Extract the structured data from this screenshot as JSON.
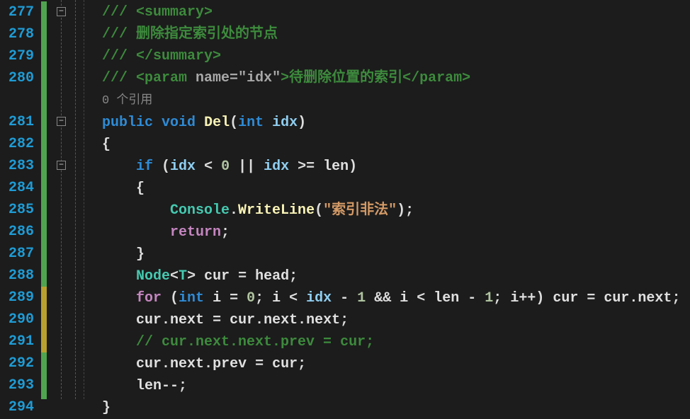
{
  "lines": {
    "n277": "277",
    "n278": "278",
    "n279": "279",
    "n280": "280",
    "n281": "281",
    "n282": "282",
    "n283": "283",
    "n284": "284",
    "n285": "285",
    "n286": "286",
    "n287": "287",
    "n288": "288",
    "n289": "289",
    "n290": "290",
    "n291": "291",
    "n292": "292",
    "n293": "293",
    "n294": "294"
  },
  "code": {
    "slash277": "/// ",
    "sum_open": "<summary>",
    "slash278": "/// ",
    "sum_text": "删除指定索引处的节点",
    "slash279": "/// ",
    "sum_close": "</summary>",
    "slash280": "/// ",
    "param_open": "<param ",
    "param_name_attr": "name",
    "param_eq": "=",
    "param_val": "\"idx\"",
    "param_close_gt": ">",
    "param_desc": "待删除位置的索引",
    "param_close": "</param>",
    "ref_text": "0 个引用",
    "public": "public",
    "void": "void",
    "del": "Del",
    "lparen": "(",
    "int": "int",
    "idx": "idx",
    "rparen": ")",
    "lbrace": "{",
    "if": "if",
    "cond_open": " (",
    "idx2": "idx",
    "lt": " < ",
    "zero": "0",
    "or": " || ",
    "idx3": "idx",
    "gte": " >= ",
    "len": "len",
    "cond_close": ")",
    "lbrace2": "{",
    "console": "Console",
    "dot1": ".",
    "writeline": "WriteLine",
    "wl_open": "(",
    "wl_str": "\"索引非法\"",
    "wl_close": ")",
    "semi1": ";",
    "return": "return",
    "semi2": ";",
    "rbrace2": "}",
    "node": "Node",
    "lt_gen": "<",
    "t": "T",
    "gt_gen": ">",
    "cur": " cur ",
    "eq1": "= ",
    "head": "head",
    "semi3": ";",
    "for": "for",
    "for_open": " (",
    "int2": "int",
    "i": " i ",
    "eq2": "= ",
    "zero2": "0",
    "sc1": "; ",
    "i2": "i",
    "lt2": " < ",
    "idx4": "idx",
    "minus1": " - ",
    "one1": "1",
    "and": " && ",
    "i3": "i",
    "lt3": " < ",
    "len2": "len",
    "minus2": " - ",
    "one2": "1",
    "sc2": "; ",
    "i4": "i",
    "inc": "++",
    "for_close": ") ",
    "cur2": "cur",
    "eq3": " = ",
    "cur3": "cur",
    "dot2": ".",
    "next1": "next",
    "semi4": ";",
    "cur4": "cur",
    "dot3": ".",
    "next2": "next",
    "eq4": " = ",
    "cur5": "cur",
    "dot4": ".",
    "next3": "next",
    "dot5": ".",
    "next4": "next",
    "semi5": ";",
    "comment_line": "// cur.next.next.prev = cur;",
    "cur6": "cur",
    "dot6": ".",
    "next5": "next",
    "dot7": ".",
    "prev1": "prev",
    "eq5": " = ",
    "cur7": "cur",
    "semi6": ";",
    "len3": "len",
    "dec": "--",
    "semi7": ";",
    "rbrace": "}"
  },
  "fold": {
    "minus": "−"
  }
}
